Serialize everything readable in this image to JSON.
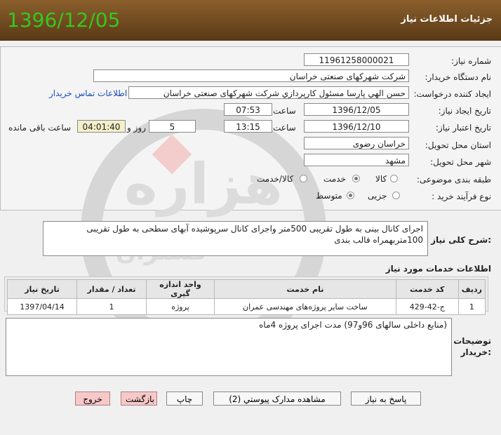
{
  "header": {
    "title": "جزئیات اطلاعات نیاز",
    "date": "1396/12/05"
  },
  "fields": {
    "need_number_label": "شماره نیاز:",
    "need_number": "11961258000021",
    "buyer_label": "نام دستگاه خریدار:",
    "buyer": "شرکت شهرکهای صنعتی خراسان",
    "creator_label": "ایجاد کننده درخواست:",
    "creator": "حسن الهي پارسا مسئول کارپردازي شرکت شهرکهای صنعتی خراسان",
    "contact_link": "اطلاعات تماس خریدار",
    "announce_label": "تاریخ ایجاد نیاز:",
    "announce_date": "1396/12/05",
    "time_word": "ساعت",
    "announce_time": "07:53",
    "validity_label": "تاریخ اعتبار نیاز:",
    "validity_date": "1396/12/10",
    "validity_time": "13:15",
    "days": "5",
    "days_word": "روز و",
    "remaining": "04:01:40",
    "remaining_word": "ساعت باقی مانده",
    "province_label": "استان محل تحویل:",
    "province": "خراسان رضوی",
    "city_label": "شهر محل تحویل:",
    "city": "مشهد",
    "category_label": "طبقه بندی موضوعی:",
    "cat_goods": "کالا",
    "cat_service": "خدمت",
    "cat_both": "کالا/خدمت",
    "process_label": "نوع فرآیند خرید :",
    "proc_partial": "جزیی",
    "proc_medium": "متوسط"
  },
  "summary": {
    "label": "شرح کلی نیاز:",
    "text_line1": "اجرای کانال بینی به طول تقریبی 500متر واجرای کانال سرپوشیده آبهای سطحی به طول تقریبی",
    "text_line2": "100متربهمراه قالب بندی"
  },
  "services": {
    "title": "اطلاعات خدمات مورد نیاز",
    "headers": [
      "ردیف",
      "کد خدمت",
      "نام خدمت",
      "واحد اندازه گیری",
      "تعداد / مقدار",
      "تاریخ نیاز"
    ],
    "rows": [
      {
        "row": "1",
        "code": "ج-42-429",
        "name": "ساخت سایر پروژه‌های مهندسی عمران",
        "unit": "پروژه",
        "qty": "1",
        "date": "1397/04/14"
      }
    ]
  },
  "notes": {
    "label_line1": "توضیحات",
    "label_line2": "خریدار:",
    "text": "(منابع داخلی سالهای 96و97) مدت اجرای پروژه 4ماه"
  },
  "buttons": {
    "reply": "پاسخ به نیاز",
    "attachments": "مشاهده مدارک پیوستي (2)",
    "print": "چاپ",
    "back": "بازگشت",
    "exit": "خروج"
  },
  "watermark": {
    "text1": "هزاره",
    "text2": "گستران"
  }
}
